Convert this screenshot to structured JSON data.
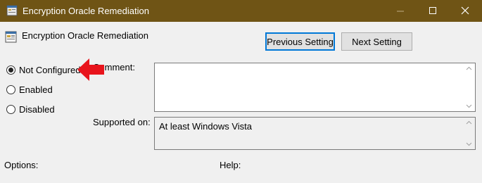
{
  "window": {
    "title": "Encryption Oracle Remediation",
    "controls": [
      "minimize",
      "maximize",
      "close"
    ],
    "titlebar_color": "#6f5415"
  },
  "header": {
    "policy_name": "Encryption Oracle Remediation",
    "previous_label": "Previous Setting",
    "next_label": "Next Setting"
  },
  "state": {
    "options": [
      {
        "label": "Not Configured",
        "checked": true
      },
      {
        "label": "Enabled",
        "checked": false
      },
      {
        "label": "Disabled",
        "checked": false
      }
    ]
  },
  "fields": {
    "comment_label": "Comment:",
    "comment_value": "",
    "supported_label": "Supported on:",
    "supported_value": "At least Windows Vista"
  },
  "footer": {
    "options_label": "Options:",
    "help_label": "Help:"
  },
  "annotation": {
    "arrow_color": "#e8141c",
    "arrow_icon": "red-arrow-pointing-left"
  }
}
